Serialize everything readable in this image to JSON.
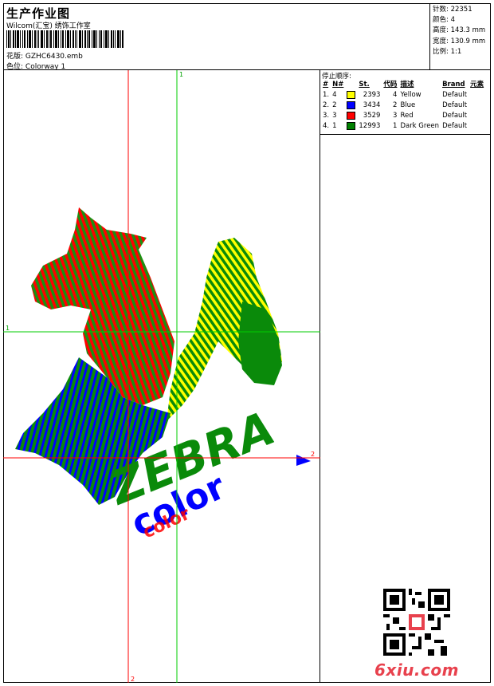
{
  "header": {
    "title": "生产作业图",
    "studio": "Wilcom(汇宝) 绣饰工作室",
    "file_label": "花版:",
    "file_value": "GZHC6430.emb",
    "colorway_label": "色位:",
    "colorway_value": "Colorway 1"
  },
  "stats": {
    "stitches_label": "针数:",
    "stitches": "22351",
    "colors_label": "颜色:",
    "colors": "4",
    "height_label": "高度:",
    "height": "143.3 mm",
    "width_label": "宽度:",
    "width": "130.9 mm",
    "scale_label": "比例:",
    "scale": "1:1"
  },
  "legend": {
    "title": "停止顺序:",
    "columns": [
      "#",
      "N#",
      "St.",
      "代码",
      "描述",
      "Brand",
      "元素"
    ],
    "rows": [
      {
        "num": "1.",
        "n": "4",
        "color": "#ffff00",
        "st": "2393",
        "code": "4",
        "desc": "Yellow",
        "brand": "Default"
      },
      {
        "num": "2.",
        "n": "2",
        "color": "#0000ff",
        "st": "3434",
        "code": "2",
        "desc": "Blue",
        "brand": "Default"
      },
      {
        "num": "3.",
        "n": "3",
        "color": "#ff0000",
        "st": "3529",
        "code": "3",
        "desc": "Red",
        "brand": "Default"
      },
      {
        "num": "4.",
        "n": "1",
        "color": "#008000",
        "st": "12993",
        "code": "1",
        "desc": "Dark Green",
        "brand": "Default"
      }
    ]
  },
  "design": {
    "axis_top_label": "1",
    "axis_left_label": "1",
    "axis_right_label": "2",
    "axis_bottom_label": "2",
    "word_zebra": "ZEBRA",
    "word_color": "color"
  },
  "watermark": {
    "text": "6xiu.com"
  },
  "colors": {
    "green": "#008000",
    "red": "#ff0000",
    "blue": "#0000ff",
    "yellow": "#ffff00",
    "logo": "#e8414d"
  }
}
